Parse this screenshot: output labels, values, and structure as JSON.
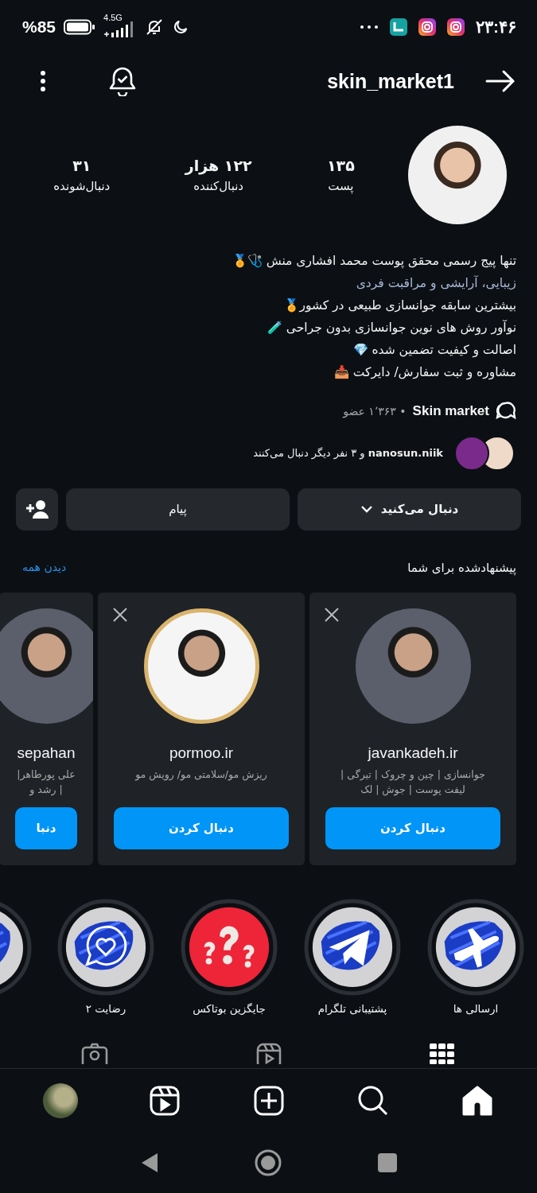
{
  "status_bar": {
    "battery": "%85",
    "network": "4.5G",
    "time": "۲۳:۴۶"
  },
  "header": {
    "username": "skin_market1"
  },
  "profile": {
    "stats": [
      {
        "value": "۱۳۵",
        "label": "پست"
      },
      {
        "value": "۱۲۲ هزار",
        "label": "دنبال‌کننده"
      },
      {
        "value": "۳۱",
        "label": "دنبال‌شونده"
      }
    ],
    "bio": [
      {
        "kind": "text",
        "text": "تنها پیج رسمی محقق پوست محمد افشاری منش 🩺🏅"
      },
      {
        "kind": "category",
        "text": "زیبایی، آرایشی و مراقبت فردی"
      },
      {
        "kind": "text",
        "text": "بیشترین سابقه جوانسازی طبیعی در کشور🏅"
      },
      {
        "kind": "text",
        "text": "نوآور روش های نوین جوانسازی بدون جراحی 🧪"
      },
      {
        "kind": "text",
        "text": "اصالت و کیفیت تضمین شده 💎"
      },
      {
        "kind": "text",
        "text": "مشاوره و ثبت سفارش/ دایرکت 📥"
      }
    ],
    "channel": {
      "name": "Skin market",
      "meta": "• ۱٬۳۶۳ عضو"
    },
    "followed_by": "**nanosun.niik** و ۳ نفر دیگر دنبال می‌کنند",
    "buttons": {
      "following": "دنبال می‌کنید",
      "message": "پیام"
    }
  },
  "suggested": {
    "title": "پیشنهادشده برای شما",
    "see_all": "دیدن همه",
    "cards": [
      {
        "name": "javankadeh.ir",
        "bio": "جوانسازی | چین و چروک | تیرگی |\nلیفت پوست | جوش | لک",
        "button": "دنبال کردن",
        "close": true,
        "ring": false
      },
      {
        "name": "pormoo.ir",
        "bio": "ریزش مو/سلامتی مو/ رویش مو",
        "button": "دنبال کردن",
        "close": true,
        "ring": true
      },
      {
        "name": "sepahan",
        "bio": "علی پورطاهر|\n| رشد و",
        "button": "دنبا",
        "close": false,
        "ring": false
      }
    ]
  },
  "highlights": [
    {
      "kind": "plane",
      "label": "ارسالی ها"
    },
    {
      "kind": "telegram",
      "label": "پشتیبانی تلگرام"
    },
    {
      "kind": "question",
      "label": "جایگزین بوتاکس"
    },
    {
      "kind": "heart-chat",
      "label": "رضایت ۲"
    },
    {
      "kind": "brush"
    }
  ],
  "profile_tabs": [
    {
      "kind": "grid",
      "selected": true
    },
    {
      "kind": "reels",
      "selected": false
    },
    {
      "kind": "tagged",
      "selected": false
    }
  ],
  "bottom_nav": [
    {
      "kind": "home",
      "selected": true
    },
    {
      "kind": "search",
      "selected": false
    },
    {
      "kind": "create",
      "selected": false
    },
    {
      "kind": "reels",
      "selected": false
    },
    {
      "kind": "profile",
      "selected": false
    }
  ]
}
